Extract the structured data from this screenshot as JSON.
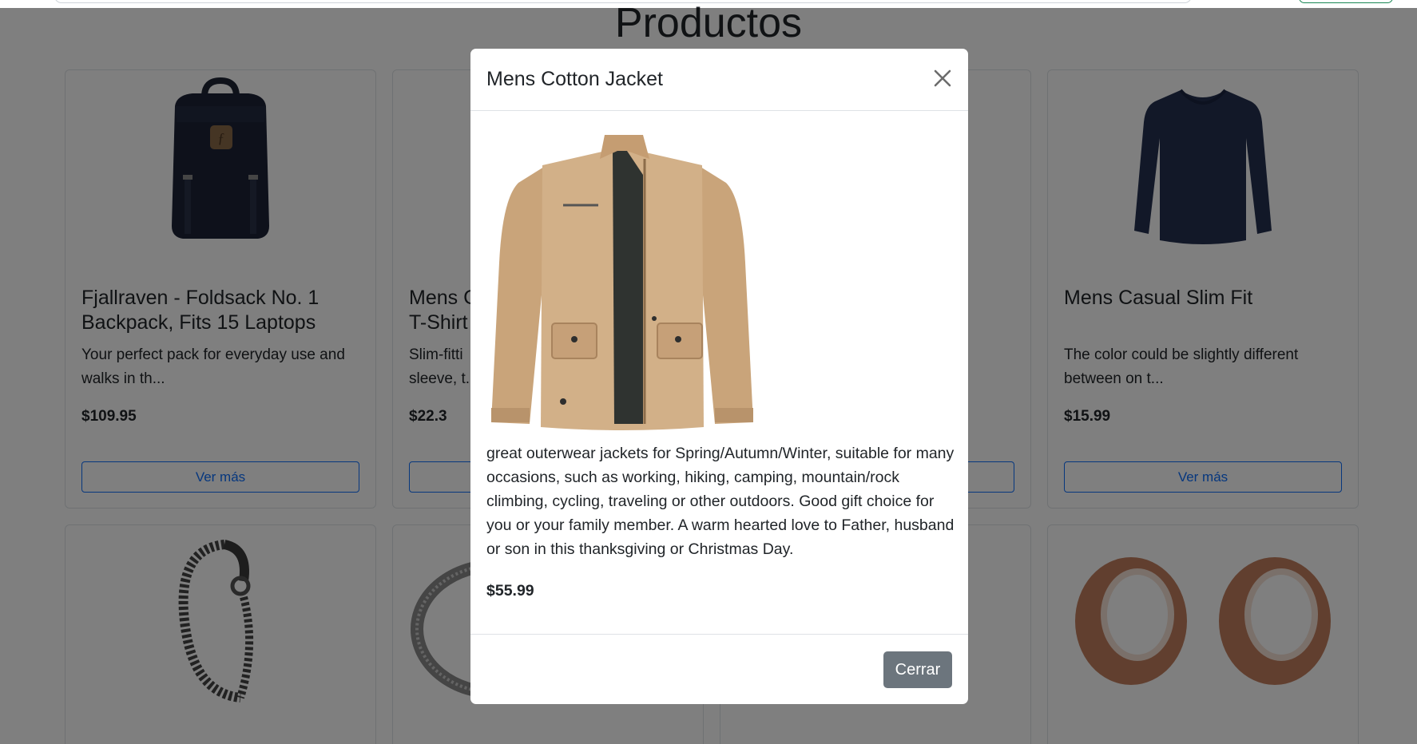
{
  "page": {
    "title": "Productos"
  },
  "products": [
    {
      "title": "Fjallraven - Foldsack No. 1 Backpack, Fits 15 Laptops",
      "description": "Your perfect pack for everyday use and walks in th...",
      "price": "$109.95",
      "button": "Ver más",
      "image": "backpack-icon"
    },
    {
      "title": "Mens C... T-Shirt...",
      "title_line1": "Mens C",
      "title_line2": "T-Shirt",
      "description_line1": "Slim-fitti",
      "description_line2": "sleeve, t...",
      "price": "$22.3",
      "image": "tshirt-icon"
    },
    {
      "title": "Mens Casual Slim Fit",
      "description": "The color could be slightly different between on t...",
      "price": "$15.99",
      "button": "Ver más",
      "image": "long-sleeve-shirt-icon"
    }
  ],
  "second_row": [
    {
      "image": "bracelet-icon"
    },
    {
      "image": "ring-icon"
    },
    {
      "image": "earrings-icon"
    }
  ],
  "modal": {
    "title": "Mens Cotton Jacket",
    "description": "great outerwear jackets for Spring/Autumn/Winter, suitable for many occasions, such as working, hiking, camping, mountain/rock climbing, cycling, traveling or other outdoors. Good gift choice for you or your family member. A warm hearted love to Father, husband or son in this thanksgiving or Christmas Day.",
    "price": "$55.99",
    "close_button": "Cerrar",
    "image": "jacket-icon"
  },
  "colors": {
    "primary": "#0d6efd",
    "secondary": "#6c757d",
    "success": "#198754"
  }
}
